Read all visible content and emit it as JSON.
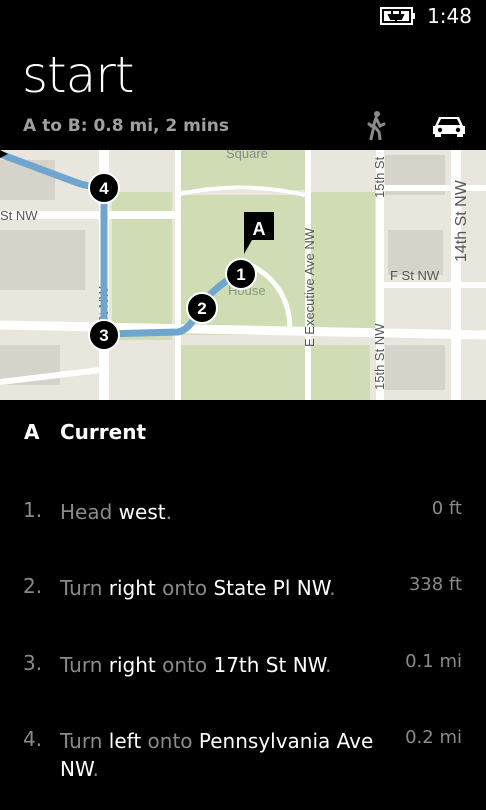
{
  "status": {
    "time": "1:48"
  },
  "header": {
    "title": "start",
    "summary": "A to B:  0.8 mi, 2 mins"
  },
  "map": {
    "labels": {
      "square": "Square",
      "st_nw_left": "St  NW",
      "seventeenth": "h St NW",
      "house": "House",
      "executive": "E  Executive  Ave  NW",
      "fifteenth_top": "15th St",
      "fourteenth": "14th St NW",
      "f_st": "F  St  NW",
      "fifteenth_bottom": "15th St NW"
    },
    "markers": [
      "1",
      "2",
      "3",
      "4"
    ],
    "pin": "A"
  },
  "origin": {
    "letter": "A",
    "label": "Current"
  },
  "steps": [
    {
      "num": "1.",
      "parts": [
        [
          "Head ",
          false
        ],
        [
          "west",
          true
        ],
        [
          ".",
          false
        ]
      ],
      "dist": "0 ft"
    },
    {
      "num": "2.",
      "parts": [
        [
          "Turn ",
          false
        ],
        [
          "right",
          true
        ],
        [
          " onto ",
          false
        ],
        [
          "State Pl NW",
          true
        ],
        [
          ".",
          false
        ]
      ],
      "dist": "338 ft"
    },
    {
      "num": "3.",
      "parts": [
        [
          "Turn ",
          false
        ],
        [
          "right",
          true
        ],
        [
          " onto ",
          false
        ],
        [
          "17th St NW",
          true
        ],
        [
          ".",
          false
        ]
      ],
      "dist": "0.1 mi"
    },
    {
      "num": "4.",
      "parts": [
        [
          "Turn ",
          false
        ],
        [
          "left",
          true
        ],
        [
          " onto ",
          false
        ],
        [
          "Pennsylvania Ave NW",
          true
        ],
        [
          ".",
          false
        ]
      ],
      "dist": "0.2 mi"
    }
  ],
  "colors": {
    "route": "#6fa6cf",
    "park": "#cfdcb4",
    "road": "#ffffff",
    "building": "#d6d3cb"
  }
}
